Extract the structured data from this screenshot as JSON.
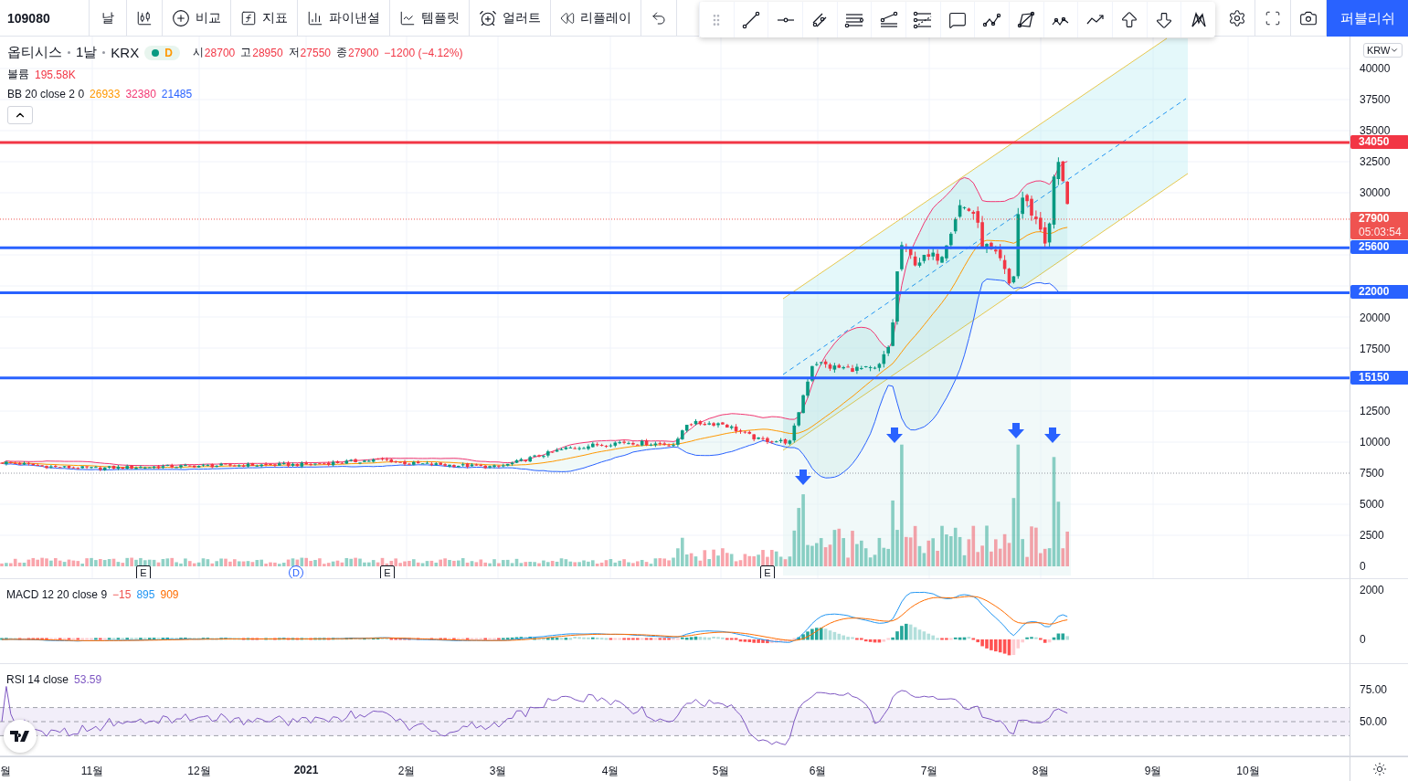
{
  "toolbar": {
    "symbol": "109080",
    "interval": "날",
    "buttons": [
      {
        "kind": "compare",
        "label": "비교"
      },
      {
        "kind": "indicators",
        "label": "지표"
      },
      {
        "kind": "financials",
        "label": "파이낸셜"
      },
      {
        "kind": "templates",
        "label": "템플릿"
      },
      {
        "kind": "alert",
        "label": "얼러트"
      },
      {
        "kind": "replay",
        "label": "리플레이"
      }
    ],
    "publish": "퍼블리쉬"
  },
  "legend": {
    "name": "옵티시스",
    "interval": "1날",
    "exchange": "KRX",
    "status": "D",
    "ohlc": [
      {
        "label": "시",
        "value": "28700"
      },
      {
        "label": "고",
        "value": "28950"
      },
      {
        "label": "저",
        "value": "27550"
      },
      {
        "label": "종",
        "value": "27900"
      }
    ],
    "change": "−1200 (−4.12%)",
    "volume_label": "볼륨",
    "volume": "195.58K",
    "bb_label": "BB 20 close 2 0",
    "bb_values": [
      {
        "text": "26933",
        "color": "#ff9800"
      },
      {
        "text": "32380",
        "color": "#f23672"
      },
      {
        "text": "21485",
        "color": "#2962ff"
      }
    ]
  },
  "price_axis": {
    "currency": "KRW",
    "ticks": [
      "40000",
      "37500",
      "35000",
      "32500",
      "30000",
      "20000",
      "17500",
      "12500",
      "10000",
      "7500",
      "5000",
      "2500",
      "0"
    ],
    "tags": [
      {
        "kind": "level",
        "text": "34050",
        "color": "#f23645"
      },
      {
        "kind": "last",
        "text": "27900",
        "countdown": "05:03:54",
        "color": "#ef5350"
      },
      {
        "kind": "level",
        "text": "25600",
        "color": "#2962ff"
      },
      {
        "kind": "level",
        "text": "22000",
        "color": "#2962ff"
      },
      {
        "kind": "level",
        "text": "15150",
        "color": "#2962ff"
      }
    ]
  },
  "event_markers": [
    {
      "kind": "earnings",
      "text": "E"
    },
    {
      "kind": "dividend",
      "text": "D"
    },
    {
      "kind": "earnings",
      "text": "E"
    },
    {
      "kind": "earnings",
      "text": "E"
    }
  ],
  "macd": {
    "label": "MACD 12 20 close 9",
    "values": [
      {
        "text": "−15",
        "color": "#ef5350"
      },
      {
        "text": "895",
        "color": "#2196f3"
      },
      {
        "text": "909",
        "color": "#ff6d00"
      }
    ],
    "ticks": [
      "2000",
      "0"
    ]
  },
  "rsi": {
    "label": "RSI 14 close",
    "value": "53.59",
    "ticks": [
      "75.00",
      "50.00"
    ]
  },
  "time_axis": [
    {
      "text": "월",
      "bold": false
    },
    {
      "text": "11월",
      "bold": false
    },
    {
      "text": "12월",
      "bold": false
    },
    {
      "text": "2021",
      "bold": true
    },
    {
      "text": "2월",
      "bold": false
    },
    {
      "text": "3월",
      "bold": false
    },
    {
      "text": "4월",
      "bold": false
    },
    {
      "text": "5월",
      "bold": false
    },
    {
      "text": "6월",
      "bold": false
    },
    {
      "text": "7월",
      "bold": false
    },
    {
      "text": "8월",
      "bold": false
    },
    {
      "text": "9월",
      "bold": false
    },
    {
      "text": "10월",
      "bold": false
    }
  ]
}
